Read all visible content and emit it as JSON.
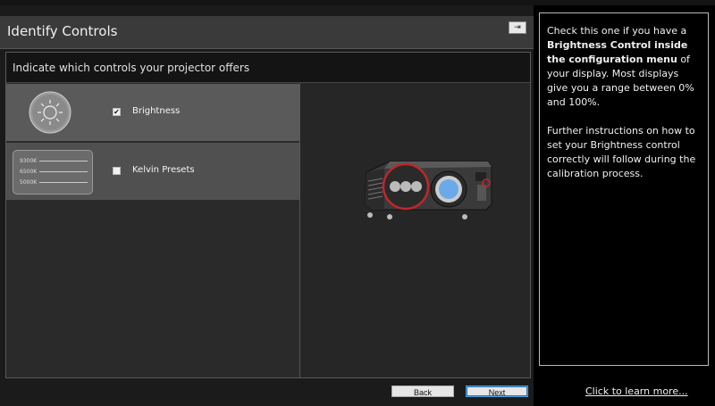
{
  "window": {
    "title": "Identify Controls",
    "pin_glyph": "⇥"
  },
  "instruction": "Indicate which controls your projector offers",
  "controls": {
    "items": [
      {
        "label": "Brightness",
        "checked": true,
        "icon": "brightness-sun-icon"
      },
      {
        "label": "Kelvin Presets",
        "checked": false,
        "icon": "kelvin-presets-icon",
        "presets": [
          "9300K",
          "6500K",
          "5000K"
        ]
      }
    ]
  },
  "preview": {
    "icon": "projector-icon"
  },
  "buttons": {
    "back": "Back",
    "next": "Next"
  },
  "help": {
    "p1_pre": "Check this one if you have a ",
    "p1_bold": "Brightness Control inside the configuration menu",
    "p1_post": " of your display. Most displays give you a range between 0% and 100%.",
    "p2": "Further instructions on how to set your Brightness control correctly will follow during the calibration process.",
    "learn_more": "Click to learn more..."
  },
  "colors": {
    "accent": "#4aa0e0",
    "highlight_circle": "#c0262c"
  }
}
